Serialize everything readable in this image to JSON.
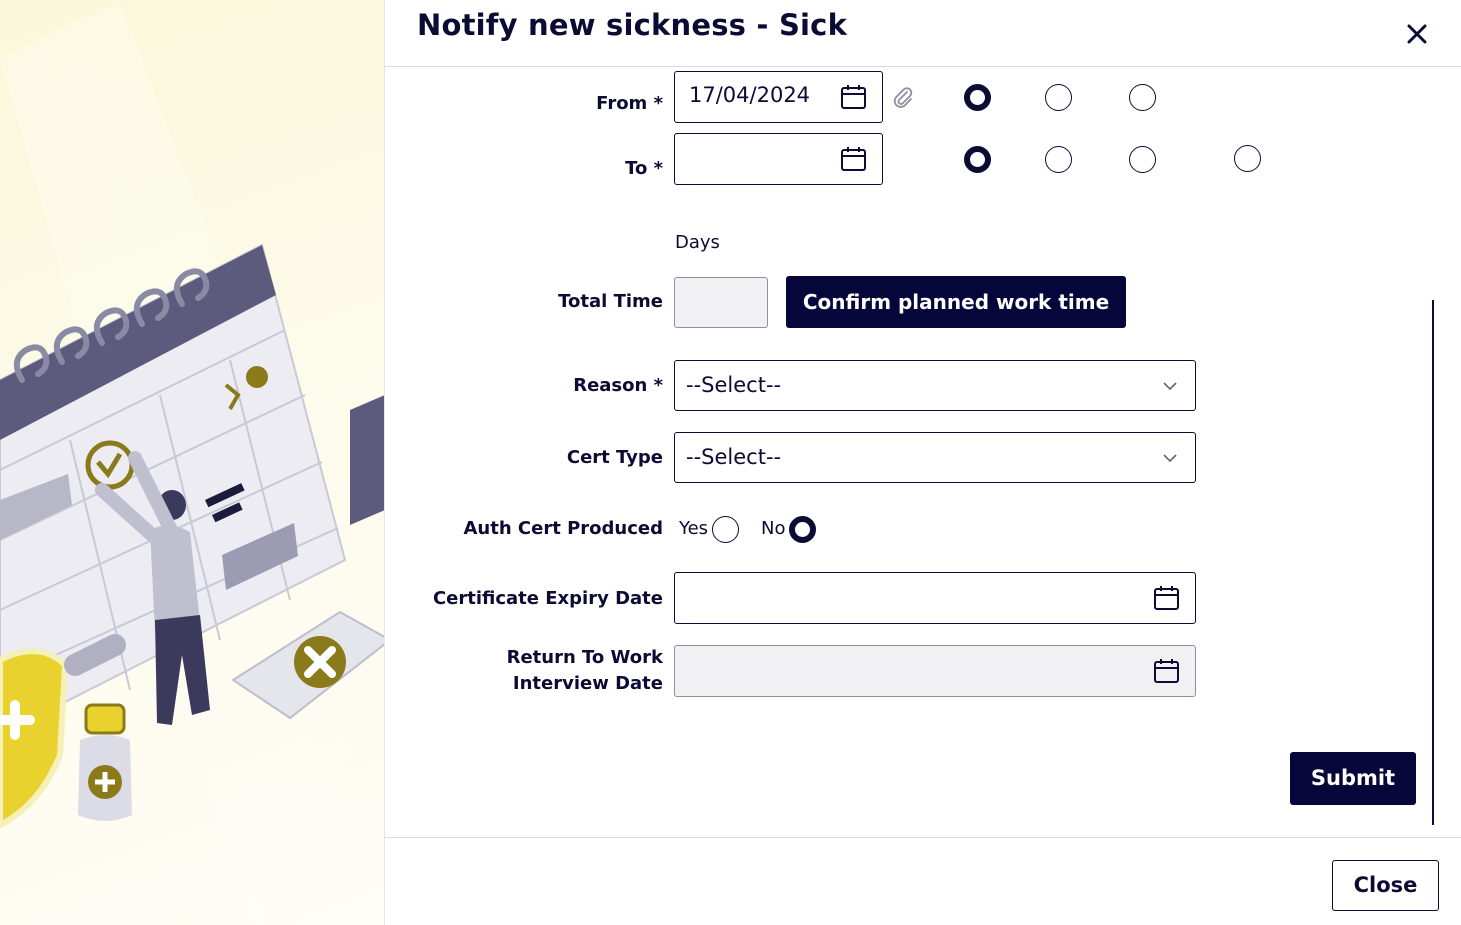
{
  "dialog": {
    "title": "Notify new sickness - Sick",
    "close_icon": "close-icon"
  },
  "form": {
    "from_label": "From *",
    "from_value": "17/04/2024",
    "to_label": "To *",
    "to_value": "",
    "days_label": "Days",
    "total_time_label": "Total Time",
    "total_time_value": "",
    "confirm_button": "Confirm planned work time",
    "reason_label": "Reason *",
    "reason_value": "--Select--",
    "cert_type_label": "Cert Type",
    "cert_type_value": "--Select--",
    "auth_cert_label": "Auth Cert Produced",
    "auth_yes": "Yes",
    "auth_no": "No",
    "auth_selected": "No",
    "cert_expiry_label": "Certificate Expiry Date",
    "rtw_label_line1": "Return To Work",
    "rtw_label_line2": "Interview Date",
    "from_radio_selected_index": 0,
    "to_radio_selected_index": 0
  },
  "actions": {
    "submit": "Submit",
    "close": "Close"
  },
  "colors": {
    "primary": "#06063a",
    "illustration_accent": "#8a7a1a",
    "illustration_bg": "#fbf7d9"
  }
}
